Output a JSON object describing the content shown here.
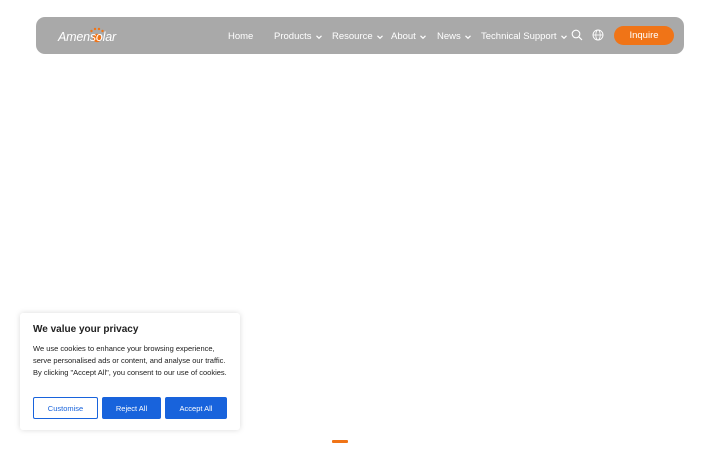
{
  "brand": {
    "logo_text": "Amensolar",
    "accent_color": "#f07417"
  },
  "nav": {
    "items": [
      {
        "label": "Home",
        "has_dropdown": false
      },
      {
        "label": "Products",
        "has_dropdown": true
      },
      {
        "label": "Resource",
        "has_dropdown": true
      },
      {
        "label": "About",
        "has_dropdown": true
      },
      {
        "label": "News",
        "has_dropdown": true
      },
      {
        "label": "Technical Support",
        "has_dropdown": true
      }
    ],
    "icons": [
      "search-icon",
      "globe-icon"
    ],
    "cta_label": "Inquire"
  },
  "cookie_banner": {
    "title": "We value your privacy",
    "body": "We use cookies to enhance your browsing experience, serve personalised ads or content, and analyse our traffic. By clicking \"Accept All\", you consent to our use of cookies.",
    "customise_label": "Customise",
    "reject_label": "Reject All",
    "accept_label": "Accept All",
    "button_color": "#1863dc"
  }
}
